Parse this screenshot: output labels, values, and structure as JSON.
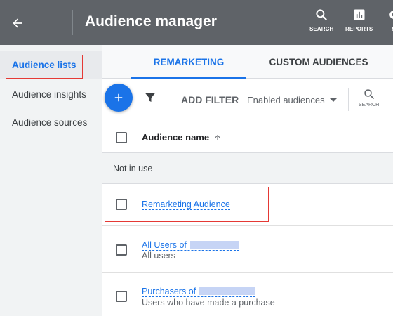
{
  "topbar": {
    "title": "Audience manager",
    "tools": [
      {
        "label": "SEARCH",
        "icon": "search-icon"
      },
      {
        "label": "REPORTS",
        "icon": "reports-icon"
      },
      {
        "label": "S",
        "icon": "settings-icon"
      }
    ]
  },
  "sidebar": {
    "items": [
      {
        "label": "Audience lists",
        "active": true
      },
      {
        "label": "Audience insights"
      },
      {
        "label": "Audience sources"
      }
    ]
  },
  "tabs": [
    {
      "label": "REMARKETING",
      "active": true
    },
    {
      "label": "CUSTOM AUDIENCES"
    }
  ],
  "toolbar": {
    "add_filter": "ADD FILTER",
    "enabled_select": "Enabled audiences",
    "search_label": "SEARCH"
  },
  "table": {
    "column_header": "Audience name",
    "group_label": "Not in use",
    "rows": [
      {
        "name": "Remarketing Audience",
        "subtitle": ""
      },
      {
        "name": "All Users of",
        "subtitle": "All users"
      },
      {
        "name": "Purchasers of",
        "subtitle": "Users who have made a purchase"
      }
    ]
  },
  "colors": {
    "topbar": "#5f6368",
    "accent": "#1a73e8",
    "highlight": "#e53935"
  }
}
